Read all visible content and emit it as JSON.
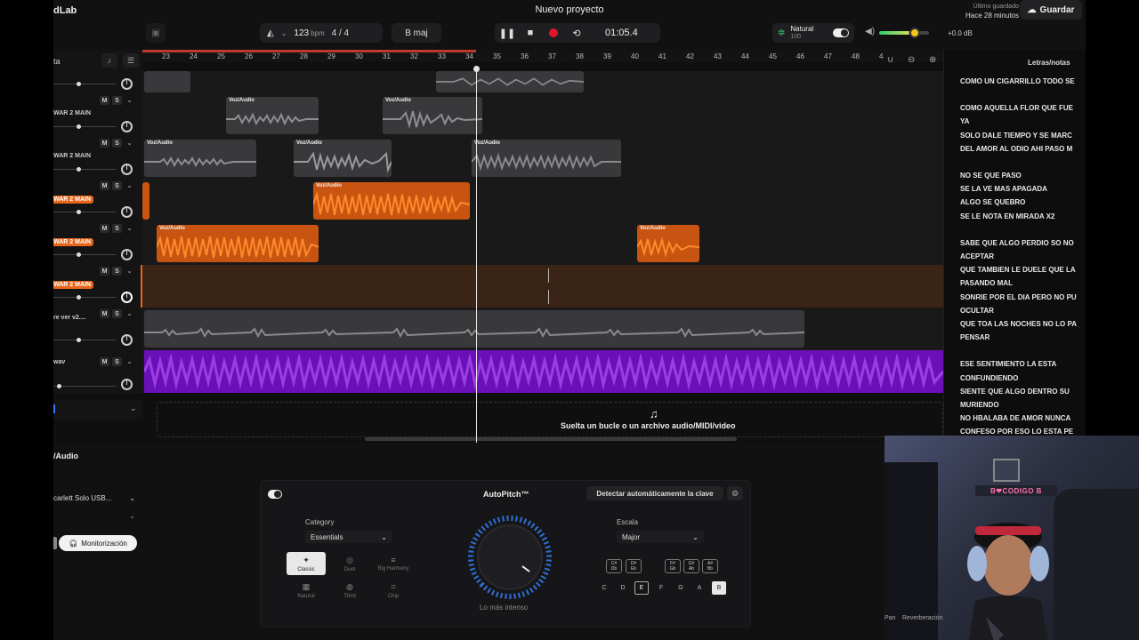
{
  "app": {
    "brand": "dLab",
    "project_title": "Nuevo proyecto"
  },
  "topbar": {
    "bpm": "123",
    "bpm_unit": "bpm",
    "time_signature": "4 / 4",
    "key": "B maj",
    "time": "01:05.4",
    "preset_name": "Natural",
    "preset_value": "100",
    "master_db": "+0.0 dB",
    "last_saved_label": "Último guardado",
    "last_saved_time": "Hace 28 minutos",
    "save_label": "Guardar"
  },
  "lanes_header": {
    "title": "ta"
  },
  "ruler": {
    "ticks": [
      "23",
      "24",
      "25",
      "26",
      "27",
      "28",
      "29",
      "30",
      "31",
      "32",
      "33",
      "34",
      "35",
      "36",
      "37",
      "38",
      "39",
      "40",
      "41",
      "42",
      "43",
      "44",
      "45",
      "46",
      "47",
      "48",
      "4"
    ]
  },
  "tracks": [
    {
      "name": "",
      "highlighted": false,
      "clips": []
    },
    {
      "name": "WAR 2 MAIN",
      "highlighted": false,
      "clip_label": "Voz/Audio"
    },
    {
      "name": "WAR 2 MAIN",
      "highlighted": false,
      "clip_label": "Voz/Audio"
    },
    {
      "name": "WAR 2 MAIN",
      "highlighted": true,
      "clip_label": "Voz/Audio"
    },
    {
      "name": "WAR 2 MAIN",
      "highlighted": true,
      "clip_label": "Voz/Audio"
    },
    {
      "name": "WAR 2 MAIN",
      "highlighted": true,
      "clip_label": ""
    },
    {
      "name": "re ver v2....",
      "highlighted": false,
      "clip_label": ""
    },
    {
      "name": "wav",
      "highlighted": false,
      "clip_label": ""
    }
  ],
  "mute_label": "M",
  "solo_label": "S",
  "drop_zone": {
    "text": "Suelta un bucle o un archivo audio/MIDI/video"
  },
  "lyrics": {
    "title": "Letras/notas",
    "lines": [
      "COMO UN CIGARRILLO TODO SE",
      "",
      "COMO AQUELLA FLOR QUE FUE",
      "YA",
      "SOLO DALE  TIEMPO Y SE  MARC",
      " DEL AMOR AL ODIO AHI PASO M",
      "",
      "NO SE QUE PASO",
      "SE LA VE MAS APAGADA",
      "ALGO SE QUEBRO",
      "SE LE NOTA EN MIRADA X2",
      "",
      "SABE QUE ALGO PERDIO SO NO",
      "ACEPTAR",
      "QUE TAMBIEN LE DUELE QUE LA",
      "PASANDO MAL",
      "SONRIE POR EL DIA PERO NO PU",
      "OCULTAR",
      "QUE TOA LAS NOCHES NO LO PA",
      "PENSAR",
      "",
      "ESE SENTIMIENTO LA ESTA",
      "CONFUNDIENDO",
      "SIENTE QUE ALGO DENTRO   SU",
      "MURIENDO",
      "NO HBALABA DE AMOR NUNCA",
      "CONFESO   POR ESO LO ESTA PE"
    ]
  },
  "bottom": {
    "track_title": "/Audio",
    "input_device": "carlett Solo USB...",
    "monitor_label": "Monitorización",
    "autopitch_title": "AutoPitch™",
    "detect_key_label": "Detectar automáticamente la clave",
    "category_label": "Category",
    "category_value": "Essentials",
    "scale_label": "Escala",
    "scale_value": "Major",
    "knob_label": "Lo más intenso",
    "styles": [
      {
        "label": "Classic",
        "active": true
      },
      {
        "label": "Duet",
        "active": false
      },
      {
        "label": "Big Harmony",
        "active": false
      },
      {
        "label": "Natural",
        "active": false
      },
      {
        "label": "Third",
        "active": false
      },
      {
        "label": "Chip",
        "active": false
      }
    ],
    "key_chips": [
      {
        "top": "C#",
        "bottom": "Db"
      },
      {
        "top": "D#",
        "bottom": "Eb"
      },
      {
        "top": "F#",
        "bottom": "Gb"
      },
      {
        "top": "G#",
        "bottom": "Ab"
      },
      {
        "top": "A#",
        "bottom": "Bb"
      }
    ],
    "naturals": [
      "C",
      "D",
      "E",
      "F",
      "G",
      "A",
      "B"
    ],
    "bottom_labels": [
      "Pan",
      "Reverberación"
    ]
  },
  "webcam": {
    "sign_text": "B❤CODIGO B"
  },
  "colors": {
    "accent_orange": "#e8671a",
    "clip_purple": "#6a10b8",
    "record_red": "#e0162b",
    "playhead": "#e6e6e6"
  }
}
